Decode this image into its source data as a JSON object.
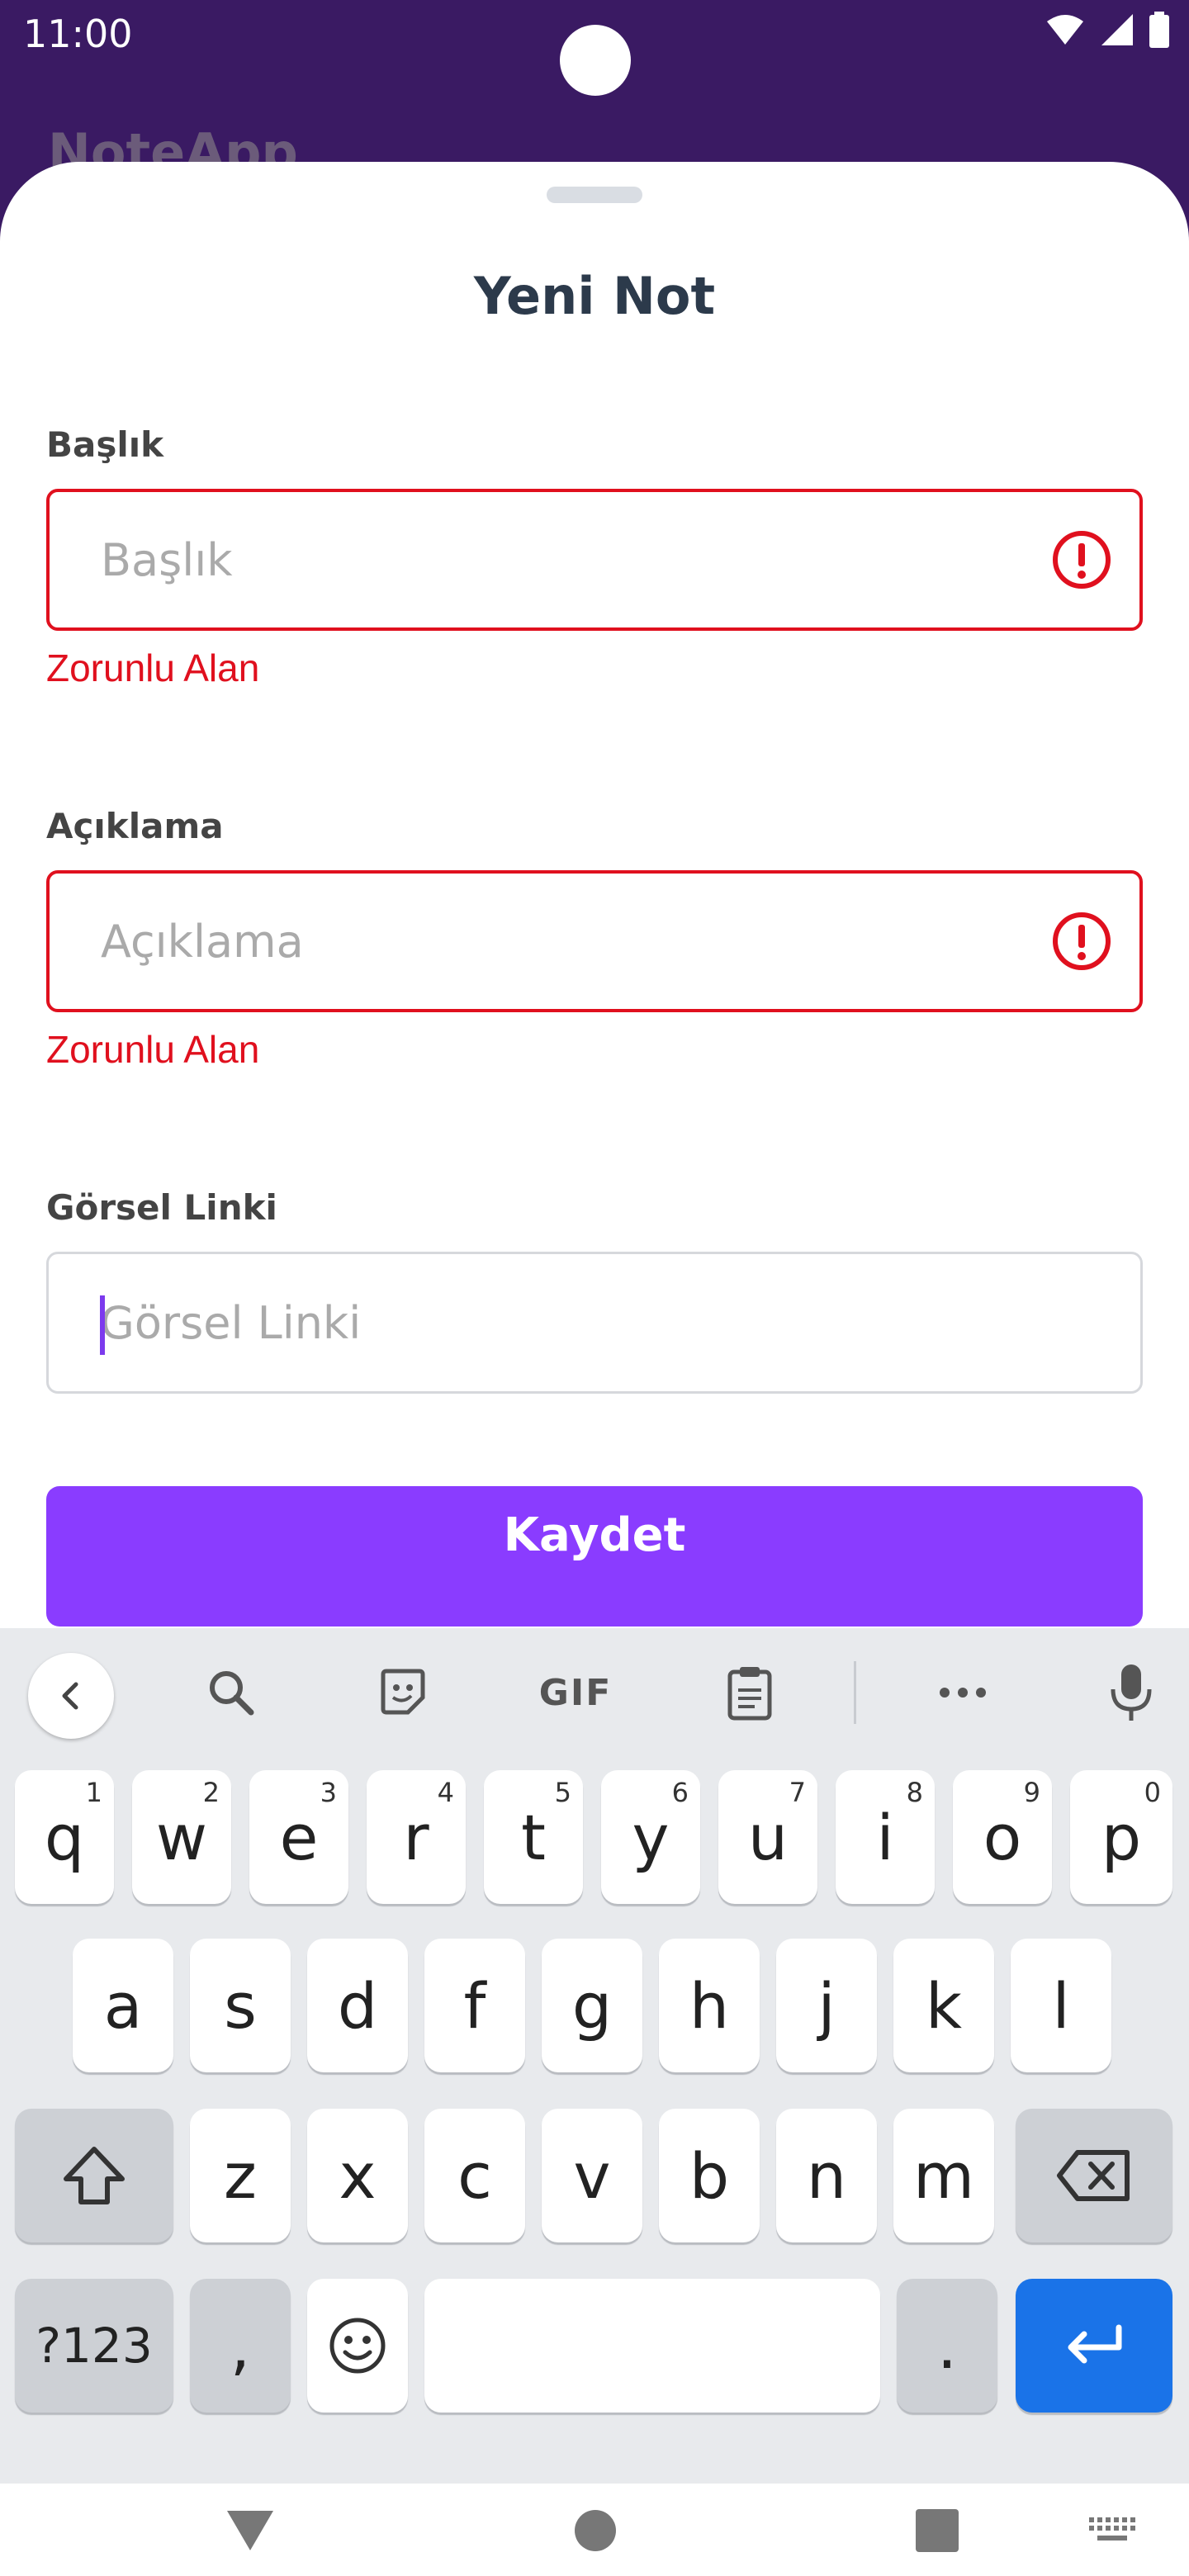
{
  "status_bar": {
    "time": "11:00"
  },
  "app_bar": {
    "title": "NoteApp"
  },
  "sheet": {
    "title": "Yeni Not",
    "fields": [
      {
        "label": "Başlık",
        "placeholder": "Başlık",
        "value": "",
        "error": "Zorunlu Alan"
      },
      {
        "label": "Açıklama",
        "placeholder": "Açıklama",
        "value": "",
        "error": "Zorunlu Alan"
      },
      {
        "label": "Görsel Linki",
        "placeholder": "Görsel Linki",
        "value": ""
      }
    ],
    "save_label": "Kaydet"
  },
  "keyboard": {
    "toolbar": {
      "gif_label": "GIF"
    },
    "row1": [
      {
        "key": "q",
        "hint": "1"
      },
      {
        "key": "w",
        "hint": "2"
      },
      {
        "key": "e",
        "hint": "3"
      },
      {
        "key": "r",
        "hint": "4"
      },
      {
        "key": "t",
        "hint": "5"
      },
      {
        "key": "y",
        "hint": "6"
      },
      {
        "key": "u",
        "hint": "7"
      },
      {
        "key": "i",
        "hint": "8"
      },
      {
        "key": "o",
        "hint": "9"
      },
      {
        "key": "p",
        "hint": "0"
      }
    ],
    "row2": [
      "a",
      "s",
      "d",
      "f",
      "g",
      "h",
      "j",
      "k",
      "l"
    ],
    "row3": [
      "z",
      "x",
      "c",
      "v",
      "b",
      "n",
      "m"
    ],
    "symbols_label": "?123",
    "comma": ",",
    "period": "."
  },
  "colors": {
    "accent": "#8a3cff",
    "error": "#e0101e",
    "app_bar": "#3a1a63",
    "enter_key": "#1a73e8"
  }
}
